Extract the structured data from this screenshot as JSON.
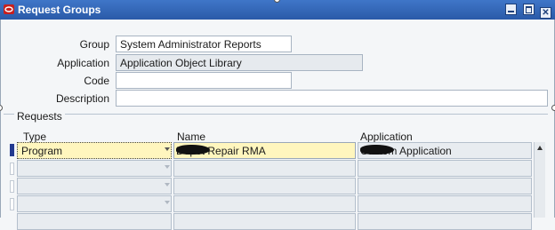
{
  "window": {
    "title": "Request Groups"
  },
  "form": {
    "group": {
      "label": "Group",
      "value": "System Administrator Reports"
    },
    "application": {
      "label": "Application",
      "value": "Application Object Library"
    },
    "code": {
      "label": "Code",
      "value": ""
    },
    "description": {
      "label": "Description",
      "value": ""
    }
  },
  "requests": {
    "section_label": "Requests",
    "columns": {
      "type": "Type",
      "name": "Name",
      "application": "Application"
    },
    "rows": [
      {
        "type": "Program",
        "name": "Depot Repair RMA",
        "application": "Custom Application"
      },
      {
        "type": "",
        "name": "",
        "application": ""
      },
      {
        "type": "",
        "name": "",
        "application": ""
      },
      {
        "type": "",
        "name": "",
        "application": ""
      },
      {
        "type": "",
        "name": "",
        "application": ""
      }
    ]
  },
  "icons": {
    "app_icon": "oracle-icon",
    "minimize": "minimize-icon",
    "maximize": "maximize-icon",
    "close": "close-icon"
  }
}
